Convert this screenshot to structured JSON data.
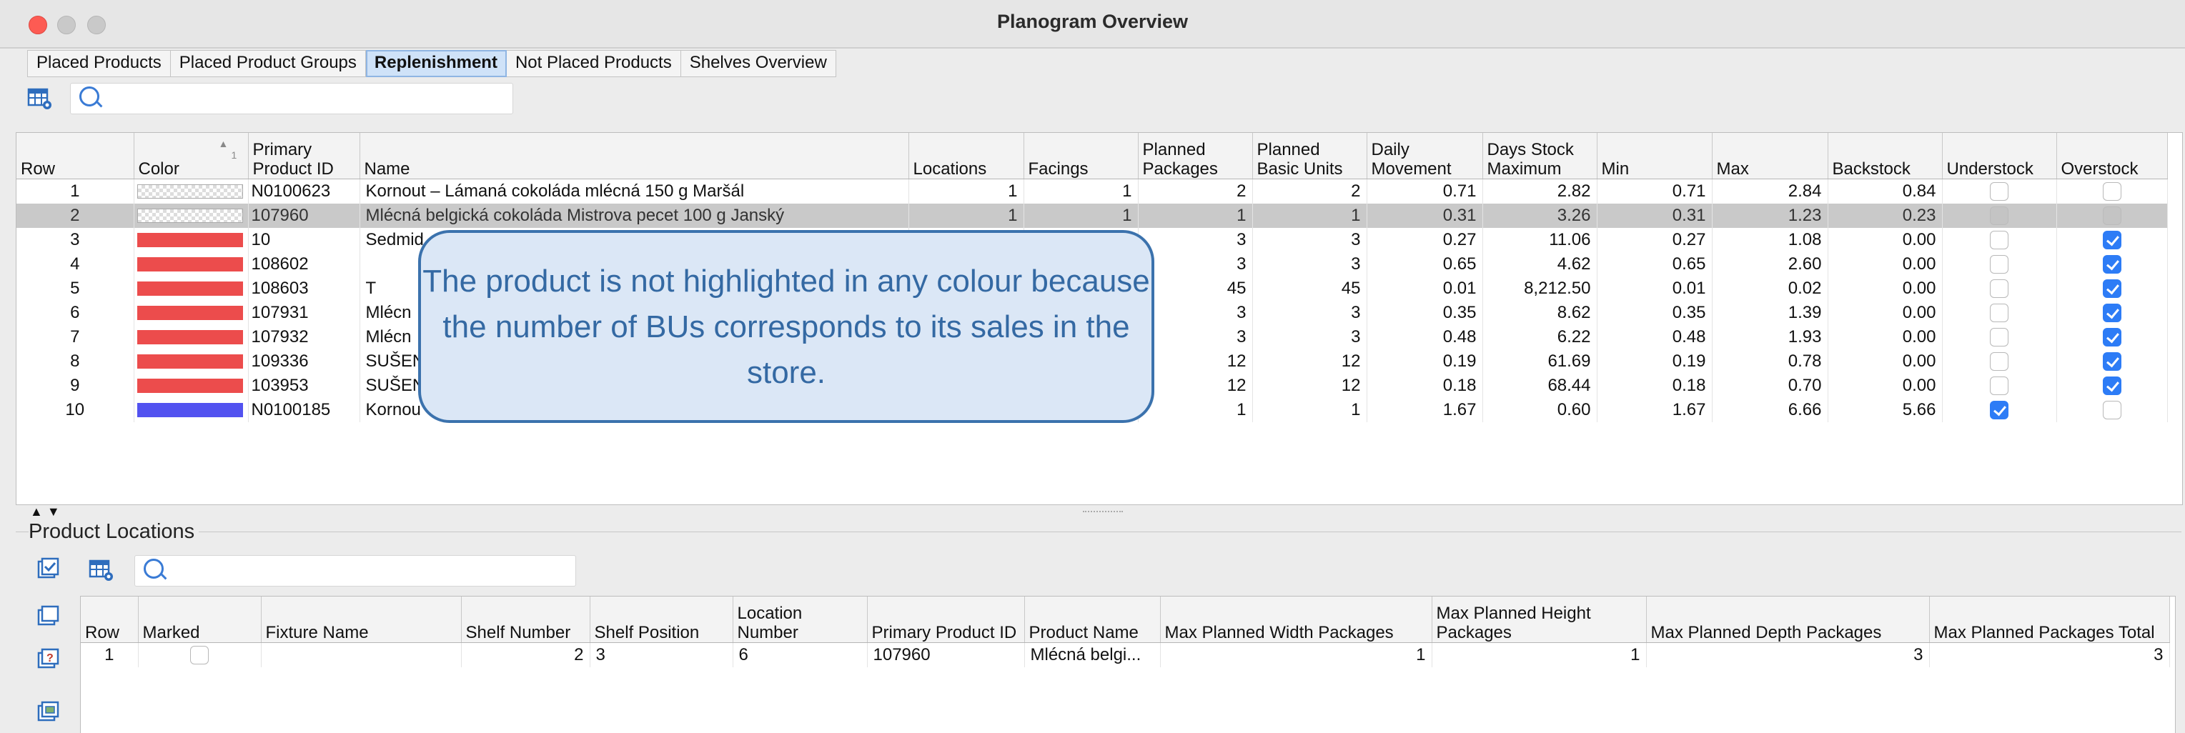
{
  "window": {
    "title": "Planogram Overview"
  },
  "tabs": [
    {
      "label": "Placed Products"
    },
    {
      "label": "Placed Product Groups"
    },
    {
      "label": "Replenishment"
    },
    {
      "label": "Not Placed Products"
    },
    {
      "label": "Shelves Overview"
    }
  ],
  "active_tab": "Replenishment",
  "top_search": {
    "value": ""
  },
  "top_table": {
    "sort_indicator": "1",
    "columns": [
      "Row",
      "Color",
      "Primary Product ID",
      "Name",
      "Locations",
      "Facings",
      "Planned Packages",
      "Planned Basic Units",
      "Daily Movement",
      "Days Stock Maximum",
      "Min",
      "Max",
      "Backstock",
      "Understock",
      "Overstock"
    ],
    "rows": [
      {
        "row": "1",
        "color": "none",
        "id": "N0100623",
        "name": "Kornout – Lámaná cokoláda mlécná 150 g Maršál",
        "locations": "1",
        "facings": "1",
        "pkgs": "2",
        "bus": "2",
        "daily": "0.71",
        "days": "2.82",
        "min": "0.71",
        "max": "2.84",
        "back": "0.84",
        "under": false,
        "over": false
      },
      {
        "row": "2",
        "color": "none",
        "id": "107960",
        "name": "Mlécná belgická cokoláda Mistrova pecet 100 g Janský",
        "locations": "1",
        "facings": "1",
        "pkgs": "1",
        "bus": "1",
        "daily": "0.31",
        "days": "3.26",
        "min": "0.31",
        "max": "1.23",
        "back": "0.23",
        "under": false,
        "over": false,
        "selected": true
      },
      {
        "row": "3",
        "color": "red",
        "id": "10",
        "name": "Sedmid",
        "locations": "",
        "facings": "",
        "pkgs": "3",
        "bus": "3",
        "daily": "0.27",
        "days": "11.06",
        "min": "0.27",
        "max": "1.08",
        "back": "0.00",
        "under": false,
        "over": true
      },
      {
        "row": "4",
        "color": "red",
        "id": "108602",
        "name": "",
        "locations": "",
        "facings": "",
        "pkgs": "3",
        "bus": "3",
        "daily": "0.65",
        "days": "4.62",
        "min": "0.65",
        "max": "2.60",
        "back": "0.00",
        "under": false,
        "over": true
      },
      {
        "row": "5",
        "color": "red",
        "id": "108603",
        "name": "T",
        "locations": "",
        "facings": "",
        "pkgs": "45",
        "bus": "45",
        "daily": "0.01",
        "days": "8,212.50",
        "min": "0.01",
        "max": "0.02",
        "back": "0.00",
        "under": false,
        "over": true
      },
      {
        "row": "6",
        "color": "red",
        "id": "107931",
        "name": "Mlécn",
        "locations": "",
        "facings": "",
        "pkgs": "3",
        "bus": "3",
        "daily": "0.35",
        "days": "8.62",
        "min": "0.35",
        "max": "1.39",
        "back": "0.00",
        "under": false,
        "over": true
      },
      {
        "row": "7",
        "color": "red",
        "id": "107932",
        "name": "Mlécn",
        "locations": "",
        "facings": "",
        "pkgs": "3",
        "bus": "3",
        "daily": "0.48",
        "days": "6.22",
        "min": "0.48",
        "max": "1.93",
        "back": "0.00",
        "under": false,
        "over": true
      },
      {
        "row": "8",
        "color": "red",
        "id": "109336",
        "name": "SUŠEN",
        "locations": "",
        "facings": "",
        "pkgs": "12",
        "bus": "12",
        "daily": "0.19",
        "days": "61.69",
        "min": "0.19",
        "max": "0.78",
        "back": "0.00",
        "under": false,
        "over": true
      },
      {
        "row": "9",
        "color": "red",
        "id": "103953",
        "name": "SUŠEN",
        "locations": "",
        "facings": "",
        "pkgs": "12",
        "bus": "12",
        "daily": "0.18",
        "days": "68.44",
        "min": "0.18",
        "max": "0.70",
        "back": "0.00",
        "under": false,
        "over": true
      },
      {
        "row": "10",
        "color": "blue",
        "id": "N0100185",
        "name": "Kornou",
        "locations": "",
        "facings": "",
        "pkgs": "1",
        "bus": "1",
        "daily": "1.67",
        "days": "0.60",
        "min": "1.67",
        "max": "6.66",
        "back": "5.66",
        "under": true,
        "over": false
      }
    ]
  },
  "callout": {
    "text": "The product is not highlighted in any colour because the number of BUs corresponds to its sales in the store."
  },
  "locations_section": {
    "title": "Product Locations",
    "search": {
      "value": ""
    },
    "columns": [
      "Row",
      "Marked",
      "Fixture Name",
      "Shelf Number",
      "Shelf Position",
      "Location Number",
      "Primary Product ID",
      "Product Name",
      "Max Planned Width Packages",
      "Max Planned Height Packages",
      "Max Planned Depth Packages",
      "Max Planned Packages Total"
    ],
    "rows": [
      {
        "row": "1",
        "marked": false,
        "fixture": "",
        "shelf_number": "2",
        "shelf_position": "3",
        "location_number": "6",
        "id": "107960",
        "product_name": "Mlécná belgi...",
        "w": "1",
        "h": "1",
        "d": "3",
        "total": "3"
      }
    ]
  },
  "colors": {
    "red": "#ec4c4c",
    "blue": "#5252f0",
    "accent": "#2d7cf6",
    "callout_border": "#3b72ad",
    "callout_fill": "#dbe7f6"
  }
}
